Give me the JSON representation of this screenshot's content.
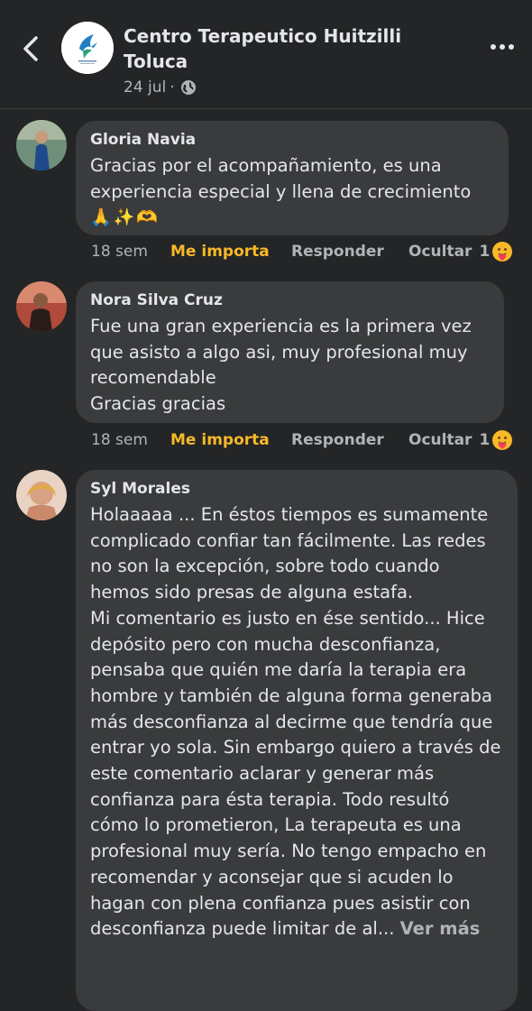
{
  "header": {
    "back_icon": "back-arrow-icon",
    "page_name": "Centro Terapeutico Huitzilli Toluca",
    "date": "24 jul",
    "separator": "·",
    "privacy_icon": "globe-icon",
    "more_icon": "more-options-icon"
  },
  "actions": {
    "like": "Me importa",
    "reply": "Responder",
    "hide": "Ocultar"
  },
  "comments": [
    {
      "author": "Gloria Navia",
      "text": "Gracias por el acompañamiento, es una experiencia especial y llena de crecimiento",
      "emoji": "🙏✨🫶",
      "time": "18 sem",
      "reaction_count": "1",
      "reaction_icon": "care-reaction-icon"
    },
    {
      "author": "Nora Silva Cruz",
      "text": "Fue una gran experiencia es la primera vez que asisto a algo asi, muy profesional muy recomendable\nGracias gracias",
      "time": "18 sem",
      "reaction_count": "1",
      "reaction_icon": "care-reaction-icon"
    },
    {
      "author": "Syl Morales",
      "text": "Holaaaaa ... En éstos tiempos es sumamente complicado confiar tan fácilmente. Las redes no son la excepción, sobre todo cuando hemos sido presas de alguna estafa.\nMi comentario es justo en ése sentido... Hice depósito pero con mucha desconfianza, pensaba que quién me daría la terapia era hombre y también de alguna forma generaba más desconfianza al decirme que tendría que entrar yo sola. Sin embargo quiero a través de este comentario aclarar y generar más confianza para ésta terapia. Todo resultó cómo lo prometieron, La terapeuta es una profesional muy sería. No tengo empacho en recomendar y aconsejar que si acuden lo hagan con plena confianza pues asistir con desconfianza puede limitar de al...",
      "see_more": "Ver más"
    }
  ]
}
